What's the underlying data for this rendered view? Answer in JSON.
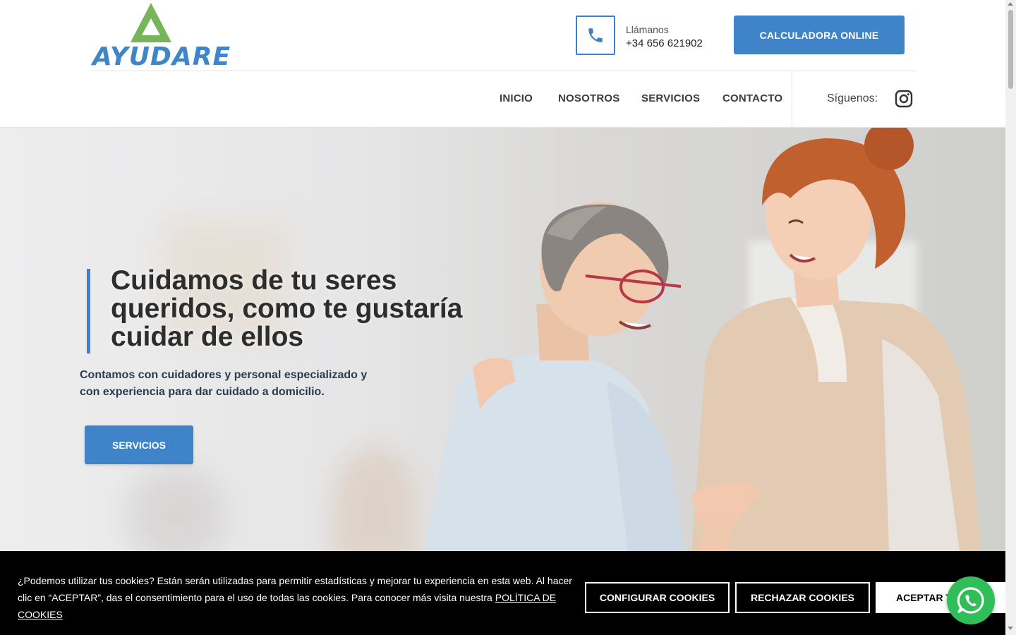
{
  "brand": {
    "name": "AYUDARE",
    "color": "#3f86c8",
    "accent": "#76b55a"
  },
  "contact": {
    "label": "Llámanos",
    "phone": "+34 656 621902"
  },
  "header": {
    "cta_label": "CALCULADORA ONLINE"
  },
  "nav": {
    "items": [
      {
        "label": "INICIO"
      },
      {
        "label": "NOSOTROS"
      },
      {
        "label": "SERVICIOS"
      },
      {
        "label": "CONTACTO"
      }
    ],
    "follow_label": "Síguenos:",
    "social_icon": "instagram-icon"
  },
  "hero": {
    "title": "Cuidamos de tu seres queridos, como te gustaría cuidar de ellos",
    "subtitle": "Contamos con cuidadores y personal especializado y con experiencia para dar cuidado a domicilio.",
    "button_label": "SERVICIOS"
  },
  "cookies": {
    "text": "¿Podemos utilizar tus cookies? Están serán utilizadas para permitir estadísticas y mejorar tu experiencia en esta web. Al hacer clic en “ACEPTAR”, das el consentimiento para el uso de todas las cookies. Para conocer más visita nuestra",
    "link_label": "POLÍTICA DE COOKIES",
    "configure_label": "CONFIGURAR COOKIES",
    "reject_label": "RECHAZAR COOKIES",
    "accept_label": "ACEPTAR TODAS"
  },
  "floating": {
    "icon": "whatsapp-icon"
  },
  "colors": {
    "primary": "#3f84c9",
    "cookie_bg": "#000000",
    "whatsapp": "#2fbe58"
  }
}
